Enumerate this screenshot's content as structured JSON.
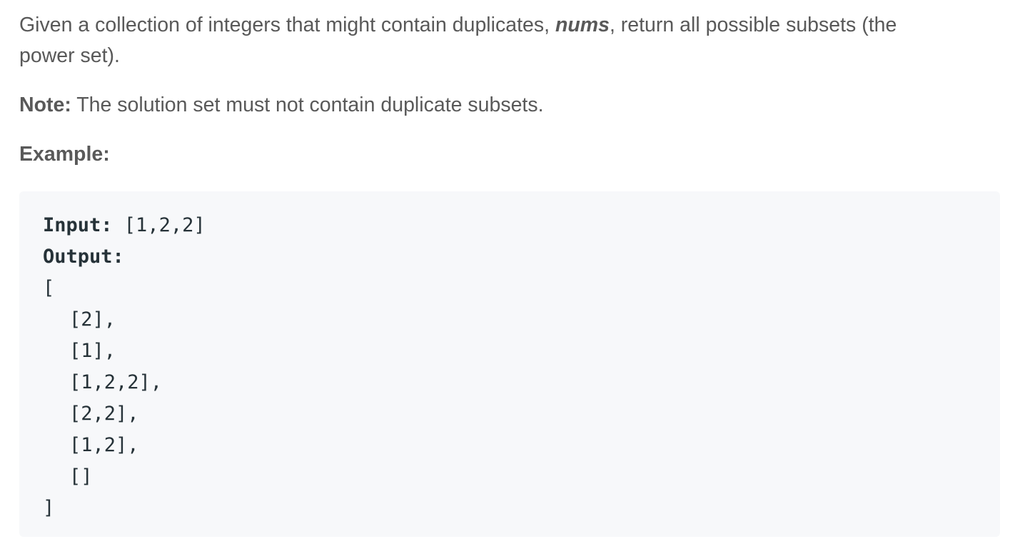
{
  "description": {
    "intro_prefix": "Given a collection of integers that might contain duplicates, ",
    "intro_var": "nums",
    "intro_suffix": ", return all possible subsets (the power set).",
    "note_label": "Note:",
    "note_text": " The solution set must not contain duplicate subsets.",
    "example_heading": "Example:"
  },
  "example": {
    "input_label": "Input:",
    "input_value": " [1,2,2]",
    "output_label": "Output:",
    "open_bracket": "[",
    "subsets": [
      "[2],",
      "[1],",
      "[1,2,2],",
      "[2,2],",
      "[1,2],",
      "[]"
    ],
    "close_bracket": "]"
  }
}
